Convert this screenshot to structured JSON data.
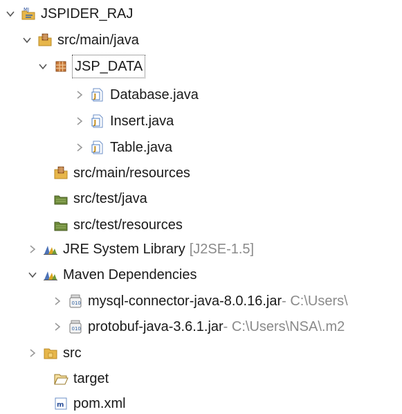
{
  "tree": {
    "project": {
      "label": "JSPIDER_RAJ",
      "icon": "maven-project-icon"
    },
    "src_main_java": {
      "label": "src/main/java",
      "icon": "source-folder-icon"
    },
    "package": {
      "label": "JSP_DATA",
      "icon": "package-icon"
    },
    "files": [
      {
        "label": "Database.java",
        "icon": "java-file-icon"
      },
      {
        "label": "Insert.java",
        "icon": "java-file-icon"
      },
      {
        "label": "Table.java",
        "icon": "java-file-icon"
      }
    ],
    "src_main_resources": {
      "label": "src/main/resources",
      "icon": "source-folder-icon"
    },
    "src_test_java": {
      "label": "src/test/java",
      "icon": "test-source-folder-icon"
    },
    "src_test_resources": {
      "label": "src/test/resources",
      "icon": "test-source-folder-icon"
    },
    "jre": {
      "label": "JRE System Library",
      "suffix": "[J2SE-1.5]",
      "icon": "library-icon"
    },
    "maven_deps": {
      "label": "Maven Dependencies",
      "icon": "library-icon"
    },
    "jars": [
      {
        "label": "mysql-connector-java-8.0.16.jar",
        "suffix": " - C:\\Users\\",
        "icon": "jar-icon"
      },
      {
        "label": "protobuf-java-3.6.1.jar",
        "suffix": " - C:\\Users\\NSA\\.m2",
        "icon": "jar-icon"
      }
    ],
    "src": {
      "label": "src",
      "icon": "folder-icon"
    },
    "target": {
      "label": "target",
      "icon": "folder-open-icon"
    },
    "pom": {
      "label": "pom.xml",
      "icon": "maven-pom-icon"
    }
  },
  "colors": {
    "text": "#1a1a1a",
    "decoration": "#8a8a8a",
    "folder": "#e7b64a",
    "package_brown": "#b06a2e",
    "java_blue": "#4b7bbf",
    "test_green": "#6d8a3a"
  }
}
